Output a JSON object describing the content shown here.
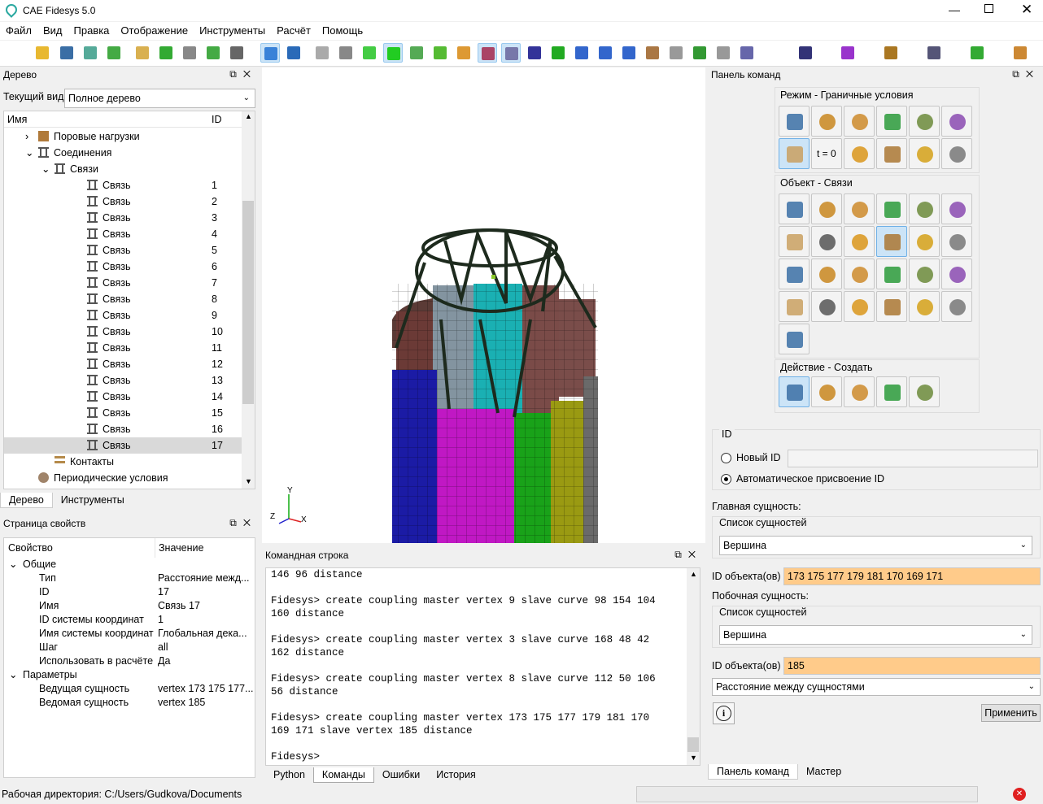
{
  "app": {
    "title": "CAE Fidesys 5.0"
  },
  "menu": [
    "Файл",
    "Вид",
    "Правка",
    "Отображение",
    "Инструменты",
    "Расчёт",
    "Помощь"
  ],
  "tree_panel": {
    "title": "Дерево",
    "current_view_label": "Текущий вид",
    "current_view_value": "Полное дерево",
    "col_name": "Имя",
    "col_id": "ID",
    "items": [
      {
        "label": "Поровые нагрузки",
        "id": "",
        "indent": 1,
        "expander": "›"
      },
      {
        "label": "Соединения",
        "id": "",
        "indent": 1,
        "expander": "⌄"
      },
      {
        "label": "Связи",
        "id": "",
        "indent": 2,
        "expander": "⌄"
      },
      {
        "label": "Связь",
        "id": "1",
        "indent": 3
      },
      {
        "label": "Связь",
        "id": "2",
        "indent": 3
      },
      {
        "label": "Связь",
        "id": "3",
        "indent": 3
      },
      {
        "label": "Связь",
        "id": "4",
        "indent": 3
      },
      {
        "label": "Связь",
        "id": "5",
        "indent": 3
      },
      {
        "label": "Связь",
        "id": "6",
        "indent": 3
      },
      {
        "label": "Связь",
        "id": "7",
        "indent": 3
      },
      {
        "label": "Связь",
        "id": "8",
        "indent": 3
      },
      {
        "label": "Связь",
        "id": "9",
        "indent": 3
      },
      {
        "label": "Связь",
        "id": "10",
        "indent": 3
      },
      {
        "label": "Связь",
        "id": "11",
        "indent": 3
      },
      {
        "label": "Связь",
        "id": "12",
        "indent": 3
      },
      {
        "label": "Связь",
        "id": "13",
        "indent": 3
      },
      {
        "label": "Связь",
        "id": "14",
        "indent": 3
      },
      {
        "label": "Связь",
        "id": "15",
        "indent": 3
      },
      {
        "label": "Связь",
        "id": "16",
        "indent": 3
      },
      {
        "label": "Связь",
        "id": "17",
        "indent": 3,
        "selected": true
      },
      {
        "label": "Контакты",
        "id": "",
        "indent": 2
      },
      {
        "label": "Периодические условия",
        "id": "",
        "indent": 1
      }
    ],
    "tabs": [
      "Дерево",
      "Инструменты"
    ]
  },
  "props_panel": {
    "title": "Страница свойств",
    "col_prop": "Свойство",
    "col_val": "Значение",
    "rows": [
      {
        "k": "Общие",
        "v": "",
        "group": true
      },
      {
        "k": "Тип",
        "v": "Расстояние межд..."
      },
      {
        "k": "ID",
        "v": "17"
      },
      {
        "k": "Имя",
        "v": "Связь 17"
      },
      {
        "k": "ID системы координат",
        "v": "1"
      },
      {
        "k": "Имя системы координат",
        "v": "Глобальная дека..."
      },
      {
        "k": "Шаг",
        "v": "all"
      },
      {
        "k": "Использовать в расчёте",
        "v": "Да"
      },
      {
        "k": "Параметры",
        "v": "",
        "group": true
      },
      {
        "k": "Ведущая сущность",
        "v": "vertex 173 175 177..."
      },
      {
        "k": "Ведомая сущность",
        "v": "vertex 185"
      }
    ]
  },
  "cmdline": {
    "title": "Командная строка",
    "lines": [
      "146 96 distance",
      "",
      "Fidesys> create coupling master vertex 9 slave curve 98 154 104",
      "160 distance",
      "",
      "Fidesys> create coupling master vertex 3 slave curve 168 48 42",
      "162 distance",
      "",
      "Fidesys> create coupling master vertex 8 slave curve 112 50 106",
      "56 distance",
      "",
      "Fidesys> create coupling master vertex 173 175 177 179 181 170",
      "169 171 slave vertex 185 distance",
      "",
      "Fidesys>"
    ],
    "tabs": [
      "Python",
      "Команды",
      "Ошибки",
      "История"
    ]
  },
  "viewport": {
    "axes": {
      "x": "X",
      "y": "Y",
      "z": "Z"
    }
  },
  "cmd_panel": {
    "title": "Панель команд",
    "mode_label": "Режим - Граничные условия",
    "t0_label": "t = 0",
    "object_label": "Объект - Связи",
    "action_label": "Действие - Создать",
    "id_group": "ID",
    "new_id": "Новый ID",
    "auto_id": "Автоматическое присвоение ID",
    "master_label": "Главная сущность:",
    "list_label": "Список сущностей",
    "master_type": "Вершина",
    "obj_id_label": "ID объекта(ов)",
    "master_ids": "173 175 177 179 181 170 169 171",
    "slave_label": "Побочная сущность:",
    "slave_type": "Вершина",
    "slave_ids": "185",
    "coupling_type": "Расстояние между сущностями",
    "apply": "Применить",
    "info": "i",
    "tabs": [
      "Панель команд",
      "Мастер"
    ]
  },
  "status": {
    "workdir": "Рабочая директория: C:/Users/Gudkova/Documents"
  }
}
